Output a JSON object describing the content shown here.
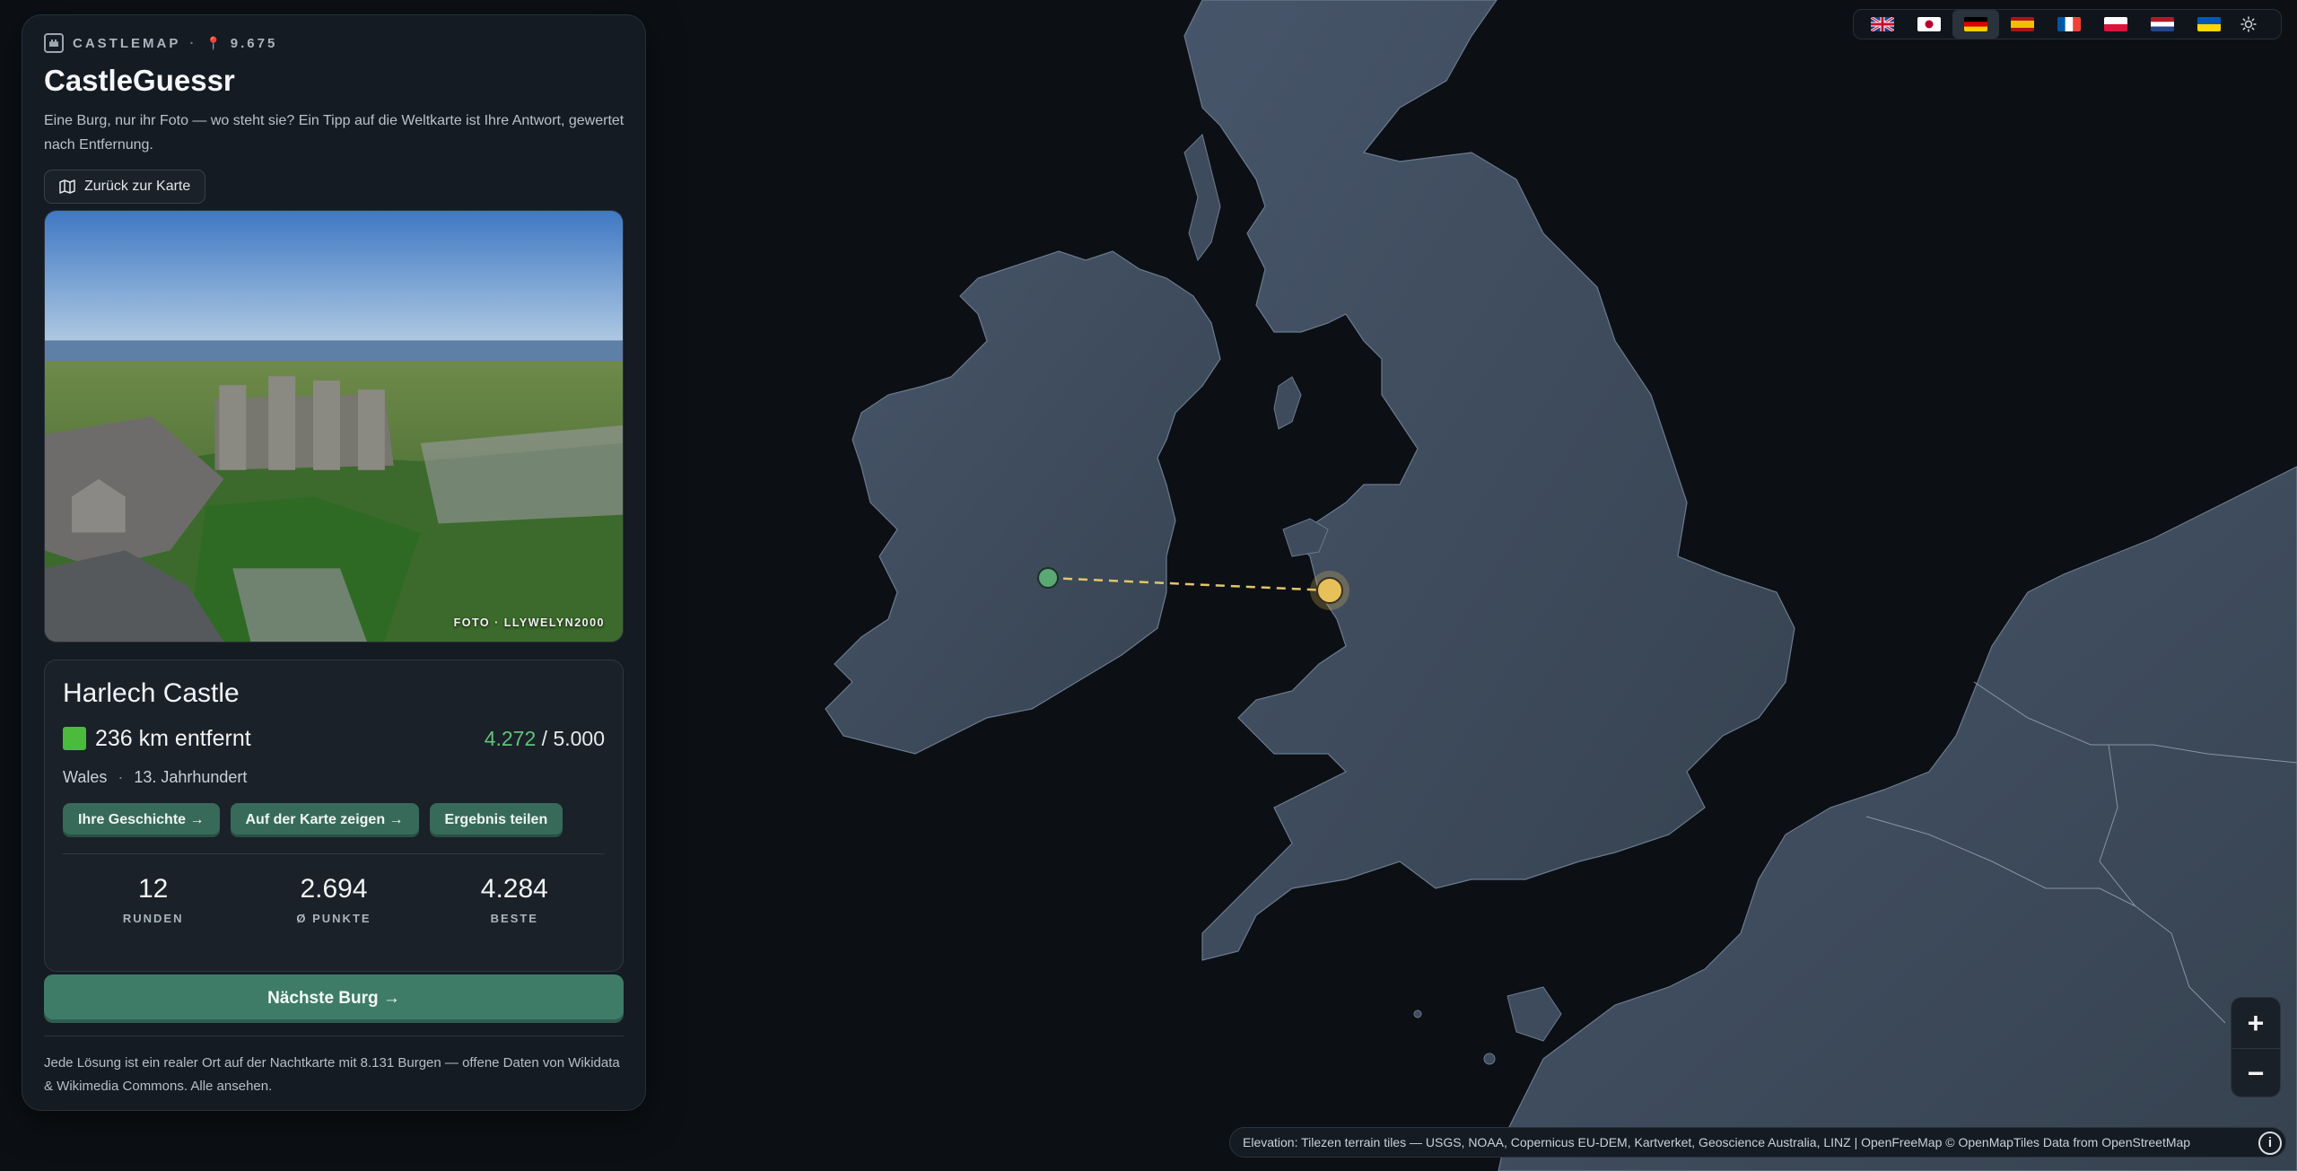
{
  "brand": {
    "name": "CASTLEMAP",
    "count": "9.675",
    "logo_icon": "castle-icon",
    "pin_icon": "pin-icon"
  },
  "app": {
    "title": "CastleGuessr",
    "subtitle": "Eine Burg, nur ihr Foto — wo steht sie? Ein Tipp auf die Weltkarte ist Ihre Antwort, gewertet nach Entfernung.",
    "back_label": "Zurück zur Karte"
  },
  "photo": {
    "credit": "FOTO · LLYWELYN2000"
  },
  "result": {
    "castle_name": "Harlech Castle",
    "distance": "236 km entfernt",
    "score_got": "4.272",
    "score_sep": " / ",
    "score_max": "5.000",
    "region": "Wales",
    "century": "13. Jahrhundert",
    "buttons": [
      "Ihre Geschichte →",
      "Auf der Karte zeigen →",
      "Ergebnis teilen"
    ]
  },
  "stats": [
    {
      "value": "12",
      "label": "RUNDEN"
    },
    {
      "value": "2.694",
      "label": "Ø PUNKTE"
    },
    {
      "value": "4.284",
      "label": "BESTE"
    }
  ],
  "next_label": "Nächste Burg →",
  "footnote": "Jede Lösung ist ein realer Ort auf der Nachtkarte mit 8.131 Burgen — offene Daten von Wikidata & Wikimedia Commons. Alle ansehen.",
  "languages": [
    {
      "code": "en",
      "icon": "uk-flag-icon",
      "active": false
    },
    {
      "code": "ja",
      "icon": "japan-flag-icon",
      "active": false
    },
    {
      "code": "de",
      "icon": "germany-flag-icon",
      "active": true
    },
    {
      "code": "es",
      "icon": "spain-flag-icon",
      "active": false
    },
    {
      "code": "fr",
      "icon": "france-flag-icon",
      "active": false
    },
    {
      "code": "pl",
      "icon": "poland-flag-icon",
      "active": false
    },
    {
      "code": "nl",
      "icon": "netherlands-flag-icon",
      "active": false
    },
    {
      "code": "uk",
      "icon": "ukraine-flag-icon",
      "active": false
    }
  ],
  "zoom": {
    "in": "+",
    "out": "−"
  },
  "attribution": "Elevation: Tilezen terrain tiles — USGS, NOAA, Copernicus EU-DEM, Kartverket, Geoscience Australia, LINZ | OpenFreeMap © OpenMapTiles Data from OpenStreetMap",
  "colors": {
    "accent": "#3e7c67",
    "guess_marker": "#5aa874",
    "answer_marker": "#e8c05a",
    "land": "#3d4a5c",
    "sea": "#0c1014"
  }
}
